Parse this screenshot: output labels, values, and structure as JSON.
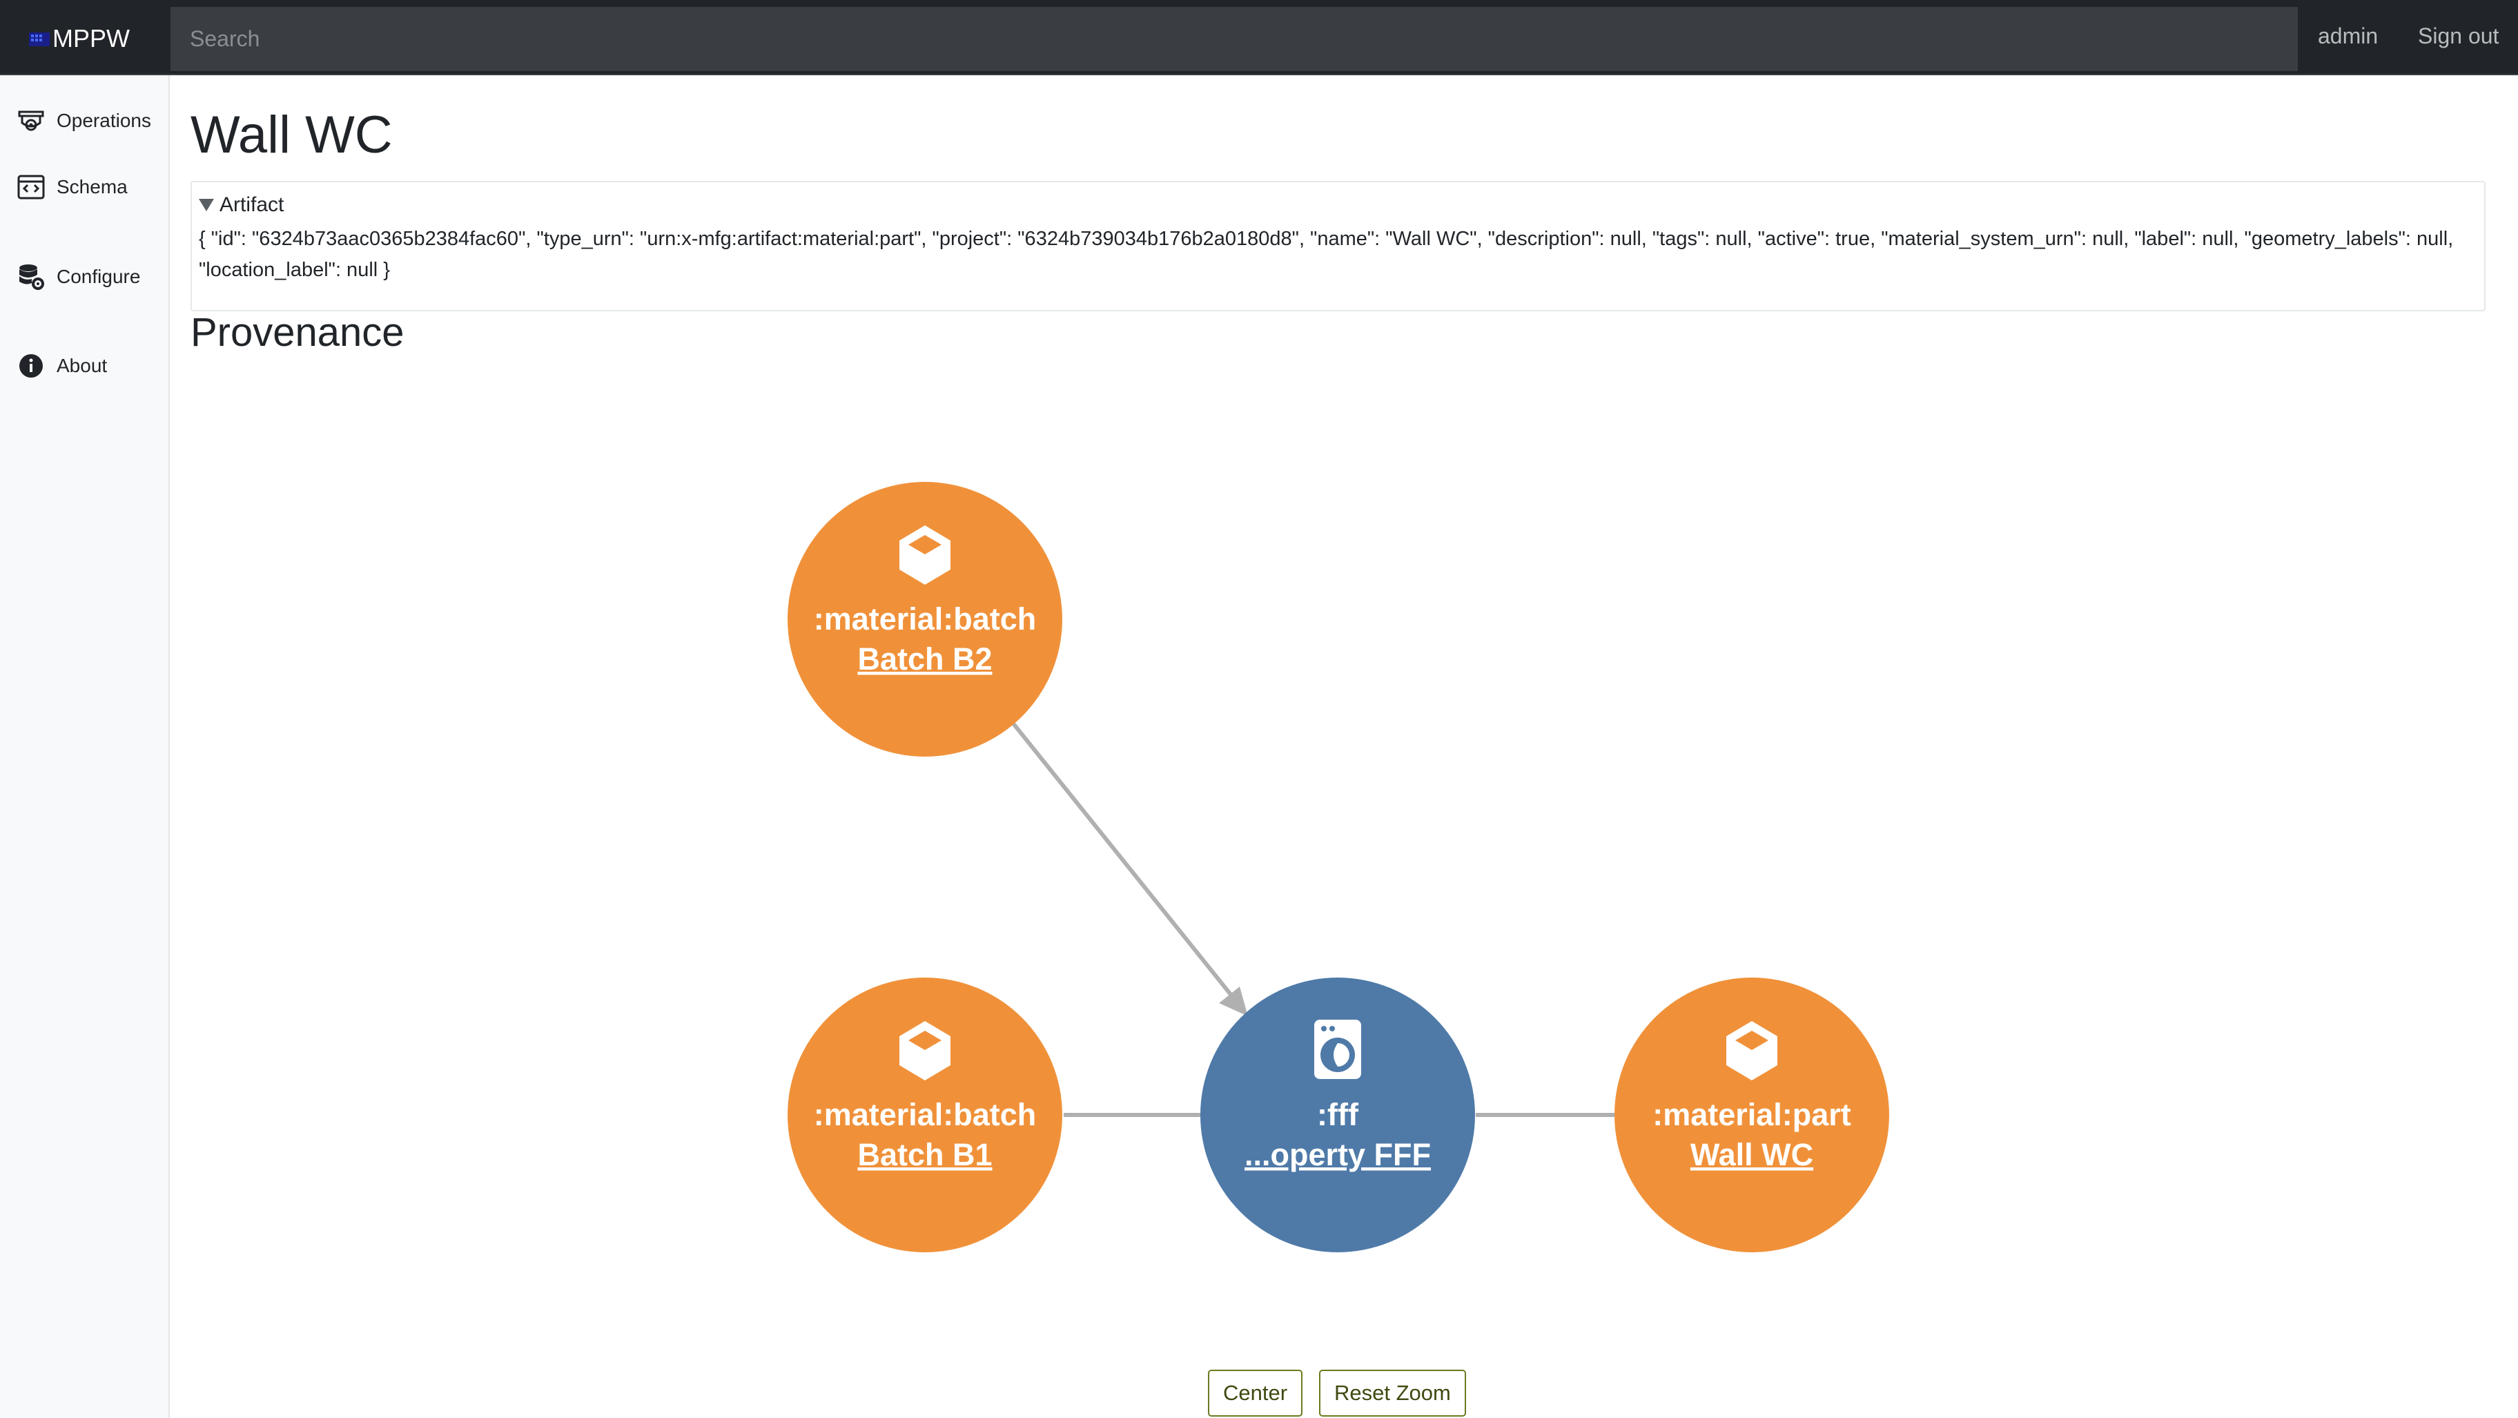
{
  "navbar": {
    "brand": "MPPW",
    "search_placeholder": "Search",
    "user": "admin",
    "signout": "Sign out"
  },
  "sidebar": {
    "items": [
      {
        "label": "Operations",
        "icon": "operations-icon"
      },
      {
        "label": "Schema",
        "icon": "schema-icon"
      },
      {
        "label": "Configure",
        "icon": "database-gear-icon"
      },
      {
        "label": "About",
        "icon": "info-icon"
      }
    ]
  },
  "page": {
    "title": "Wall WC",
    "artifact_summary": "Artifact",
    "artifact_json": "{ \"id\": \"6324b73aac0365b2384fac60\", \"type_urn\": \"urn:x-mfg:artifact:material:part\", \"project\": \"6324b739034b176b2a0180d8\", \"name\": \"Wall WC\", \"description\": null, \"tags\": null, \"active\": true, \"material_system_urn\": null, \"label\": null, \"geometry_labels\": null, \"location_label\": null }",
    "provenance_title": "Provenance"
  },
  "graph": {
    "colors": {
      "material": "#f0913a",
      "operation": "#4f7aa8",
      "edge": "#b0b0b0"
    },
    "nodes": [
      {
        "type": ":material:batch",
        "label": "Batch B2",
        "icon": "cube-icon"
      },
      {
        "type": ":material:batch",
        "label": "Batch B1",
        "icon": "cube-icon"
      },
      {
        "type": ":fff",
        "label": "...operty FFF",
        "icon": "washing-machine-icon"
      },
      {
        "type": ":material:part",
        "label": "Wall WC",
        "icon": "cube-icon"
      }
    ]
  },
  "controls": {
    "center": "Center",
    "reset_zoom": "Reset Zoom"
  }
}
